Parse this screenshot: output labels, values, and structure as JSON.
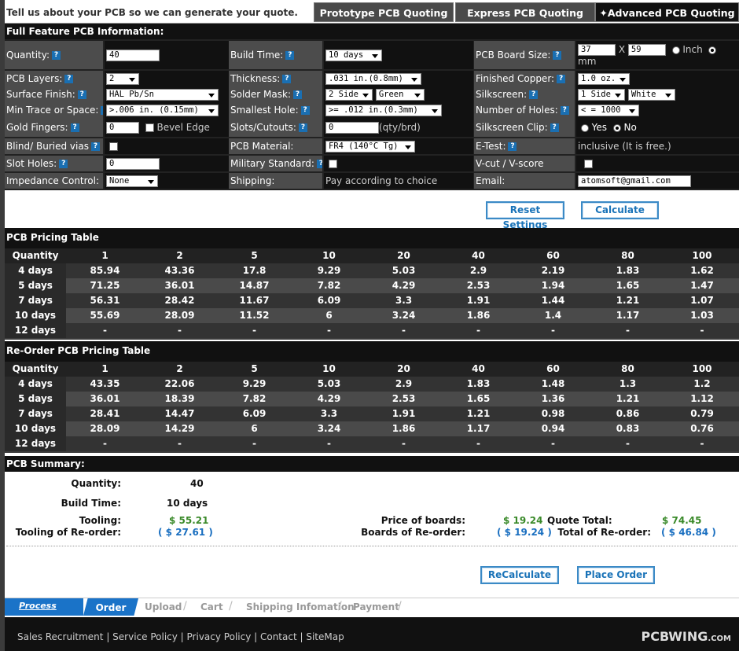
{
  "header": {
    "intro": "Tell us about your PCB so we can generate your quote.",
    "tabs": [
      "Prototype PCB Quoting",
      "Express PCB Quoting",
      "Advanced PCB Quoting"
    ]
  },
  "form_title": "Full Feature PCB Information:",
  "form": {
    "quantity": {
      "label": "Quantity:",
      "value": "40"
    },
    "build_time": {
      "label": "Build Time:",
      "value": "10 days"
    },
    "board_size": {
      "label": "PCB Board Size:",
      "w": "37",
      "x": "X",
      "h": "59",
      "inch": "Inch",
      "mm": "mm"
    },
    "layers": {
      "label": "PCB Layers:",
      "value": "2"
    },
    "thickness": {
      "label": "Thickness:",
      "value": ".031 in.(0.8mm)"
    },
    "copper": {
      "label": "Finished Copper:",
      "value": "1.0 oz."
    },
    "surface": {
      "label": "Surface Finish:",
      "value": "HAL Pb/Sn"
    },
    "mask": {
      "label": "Solder Mask:",
      "side": "2 Side",
      "color": "Green"
    },
    "silkscreen": {
      "label": "Silkscreen:",
      "side": "1 Side",
      "color": "White"
    },
    "trace": {
      "label": "Min Trace or Space:",
      "value": ">.006 in. (0.15mm)"
    },
    "hole": {
      "label": "Smallest Hole:",
      "value": ">= .012 in.(0.3mm)"
    },
    "num_holes": {
      "label": "Number of Holes:",
      "value": "< = 1000"
    },
    "gold": {
      "label": "Gold Fingers:",
      "value": "0",
      "bevel": "Bevel Edge"
    },
    "slots": {
      "label": "Slots/Cutouts:",
      "value": "0",
      "unit": "(qty/brd)"
    },
    "clip": {
      "label": "Silkscreen Clip:",
      "yes": "Yes",
      "no": "No"
    },
    "blind": {
      "label": "Blind/ Buried vias"
    },
    "material": {
      "label": "PCB Material:",
      "value": "FR4 (140°C Tg)"
    },
    "etest": {
      "label": "E-Test:",
      "value": "inclusive (It is free.)"
    },
    "slot_holes": {
      "label": "Slot Holes:",
      "value": "0"
    },
    "military": {
      "label": "Military Standard:"
    },
    "vcut": {
      "label": "V-cut / V-score"
    },
    "impedance": {
      "label": "Impedance Control:",
      "value": "None"
    },
    "shipping": {
      "label": "Shipping:",
      "value": "Pay according to choice"
    },
    "email": {
      "label": "Email:",
      "value": "atomsoft@gmail.com"
    }
  },
  "buttons": {
    "reset": "Reset Settings",
    "calculate": "Calculate",
    "recalculate": "ReCalculate",
    "place_order": "Place Order"
  },
  "pricing": {
    "title": "PCB Pricing Table",
    "header": [
      "Quantity",
      "1",
      "2",
      "5",
      "10",
      "20",
      "40",
      "60",
      "80",
      "100"
    ],
    "rows": [
      [
        "4 days",
        "85.94",
        "43.36",
        "17.8",
        "9.29",
        "5.03",
        "2.9",
        "2.19",
        "1.83",
        "1.62"
      ],
      [
        "5 days",
        "71.25",
        "36.01",
        "14.87",
        "7.82",
        "4.29",
        "2.53",
        "1.94",
        "1.65",
        "1.47"
      ],
      [
        "7 days",
        "56.31",
        "28.42",
        "11.67",
        "6.09",
        "3.3",
        "1.91",
        "1.44",
        "1.21",
        "1.07"
      ],
      [
        "10 days",
        "55.69",
        "28.09",
        "11.52",
        "6",
        "3.24",
        "1.86",
        "1.4",
        "1.17",
        "1.03"
      ],
      [
        "12 days",
        "-",
        "-",
        "-",
        "-",
        "-",
        "-",
        "-",
        "-",
        "-"
      ]
    ]
  },
  "reorder": {
    "title": "Re-Order PCB Pricing Table",
    "header": [
      "Quantity",
      "1",
      "2",
      "5",
      "10",
      "20",
      "40",
      "60",
      "80",
      "100"
    ],
    "rows": [
      [
        "4 days",
        "43.35",
        "22.06",
        "9.29",
        "5.03",
        "2.9",
        "1.83",
        "1.48",
        "1.3",
        "1.2"
      ],
      [
        "5 days",
        "36.01",
        "18.39",
        "7.82",
        "4.29",
        "2.53",
        "1.65",
        "1.36",
        "1.21",
        "1.12"
      ],
      [
        "7 days",
        "28.41",
        "14.47",
        "6.09",
        "3.3",
        "1.91",
        "1.21",
        "0.98",
        "0.86",
        "0.79"
      ],
      [
        "10 days",
        "28.09",
        "14.29",
        "6",
        "3.24",
        "1.86",
        "1.17",
        "0.94",
        "0.83",
        "0.76"
      ],
      [
        "12 days",
        "-",
        "-",
        "-",
        "-",
        "-",
        "-",
        "-",
        "-",
        "-"
      ]
    ]
  },
  "summary": {
    "title": "PCB Summary:",
    "quantity_label": "Quantity:",
    "quantity": "40",
    "build_label": "Build Time:",
    "build": "10 days",
    "tooling_label": "Tooling:",
    "tooling": "$ 55.21",
    "tooling_reorder_label": "Tooling of Re-order:",
    "tooling_reorder": "( $ 27.61 )",
    "price_label": "Price of boards:",
    "price": "$ 19.24",
    "boards_reorder_label": "Boards of Re-order:",
    "boards_reorder": "( $ 19.24 )",
    "total_label": "Quote Total:",
    "total": "$ 74.45",
    "total_reorder_label": "Total of Re-order:",
    "total_reorder": "( $ 46.84 )"
  },
  "process": {
    "label": "Process",
    "steps": [
      "Order",
      "Upload",
      "Cart",
      "Shipping Infomation",
      "Payment"
    ]
  },
  "footer": {
    "links": [
      "Sales Recruitment",
      "Service Policy",
      "Privacy Policy",
      "Contact",
      "SiteMap"
    ],
    "brand": "PCBWING",
    "brand_suffix": ".COM"
  },
  "colors": {
    "help_icon": "#1a6fb2",
    "tab_active": "#111111",
    "price_green": "#3a8a2a",
    "price_blue": "#1a6fc0"
  }
}
